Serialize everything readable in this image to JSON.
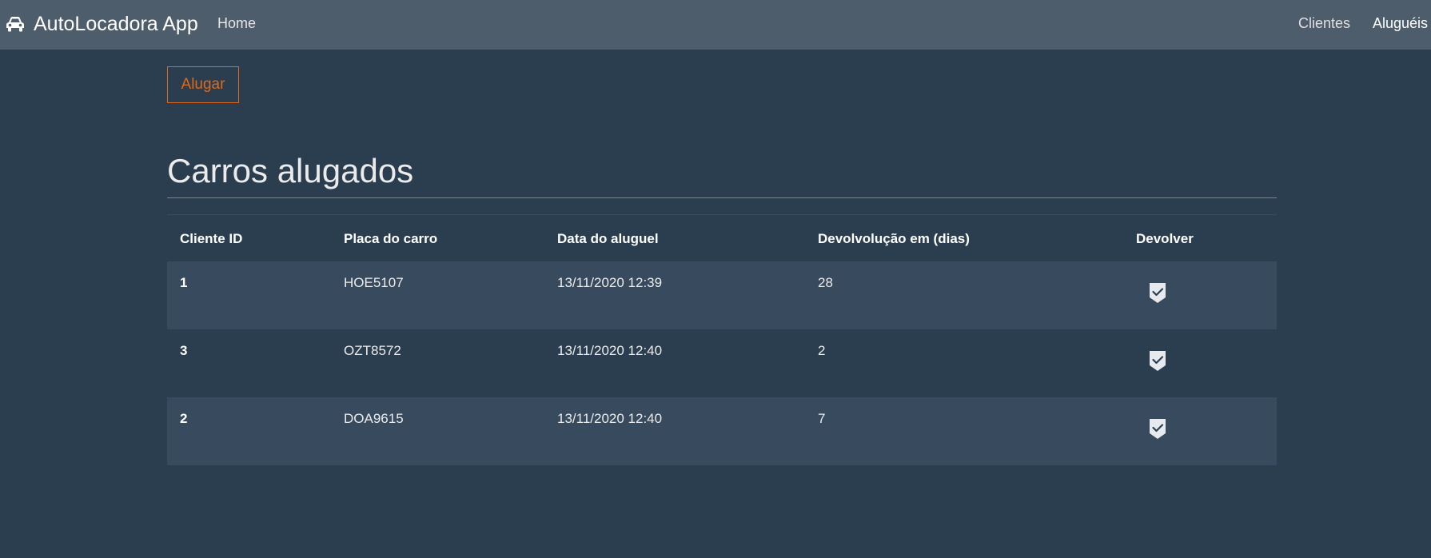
{
  "navbar": {
    "brand": "AutoLocadora App",
    "brand_icon": "car-icon",
    "home": "Home",
    "clientes": "Clientes",
    "alugueis": "Aluguéis"
  },
  "actions": {
    "alugar": "Alugar"
  },
  "page": {
    "title": "Carros alugados"
  },
  "table": {
    "headers": [
      "Cliente ID",
      "Placa do carro",
      "Data do aluguel",
      "Devolvolução em (dias)",
      "Devolver"
    ],
    "rows": [
      {
        "cliente_id": "1",
        "placa": "HOE5107",
        "data": "13/11/2020 12:39",
        "dias": "28"
      },
      {
        "cliente_id": "3",
        "placa": "OZT8572",
        "data": "13/11/2020 12:40",
        "dias": "2"
      },
      {
        "cliente_id": "2",
        "placa": "DOA9615",
        "data": "13/11/2020 12:40",
        "dias": "7"
      }
    ],
    "return_icon": "shield-check-icon"
  },
  "colors": {
    "background": "#2b3e50",
    "navbar": "#4e5d6c",
    "accent": "#df691a",
    "striped_row": "#384a5d"
  }
}
